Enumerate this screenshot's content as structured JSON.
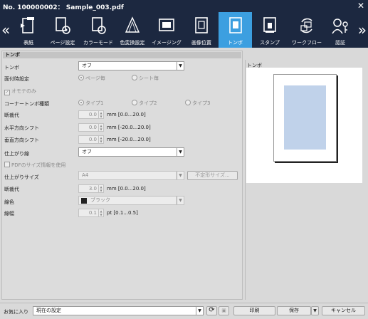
{
  "window": {
    "title": "No. 100000002： Sample_003.pdf"
  },
  "ribbon": {
    "tabs": [
      {
        "label": "表紙",
        "icon": "cover-icon"
      },
      {
        "label": "ページ設定",
        "icon": "page-settings-icon"
      },
      {
        "label": "カラーモード",
        "icon": "color-mode-icon"
      },
      {
        "label": "色変換設定",
        "icon": "color-conversion-icon"
      },
      {
        "label": "イメージング",
        "icon": "imaging-icon"
      },
      {
        "label": "画像位置",
        "icon": "image-position-icon"
      },
      {
        "label": "トンボ",
        "icon": "crop-marks-icon",
        "active": true
      },
      {
        "label": "スタンプ",
        "icon": "stamp-icon"
      },
      {
        "label": "ワークフロー",
        "icon": "workflow-icon"
      },
      {
        "label": "認証",
        "icon": "auth-icon"
      }
    ]
  },
  "section": {
    "title": "トンボ"
  },
  "form": {
    "tombo_label": "トンボ",
    "tombo_value": "オフ",
    "binding_label": "面付時設定",
    "per_page": "ページ毎",
    "per_sheet": "シート毎",
    "front_only": "オモテのみ",
    "corner_label": "コーナートンボ種類",
    "type1": "タイプ1",
    "type2": "タイプ2",
    "type3": "タイプ3",
    "bleed_label": "断裁代",
    "bleed_value": "0.0",
    "bleed_unit": "mm [0.0...20.0]",
    "hshift_label": "水平方向シフト",
    "hshift_value": "0.0",
    "hshift_unit": "mm [-20.0...20.0]",
    "vshift_label": "垂直方向シフト",
    "vshift_value": "0.0",
    "vshift_unit": "mm [-20.0...20.0]",
    "finish_label": "仕上がり線",
    "finish_value": "オフ",
    "use_pdf_size": "PDFのサイズ情報を使用",
    "finish_size_label": "仕上がりサイズ",
    "finish_size_value": "A4",
    "custom_size_button": "不定形サイズ...",
    "bleed2_label": "断裁代",
    "bleed2_value": "3.0",
    "bleed2_unit": "mm [0.0...20.0]",
    "line_color_label": "線色",
    "line_color_value": "ブラック",
    "line_width_label": "線幅",
    "line_width_value": "0.1",
    "line_width_unit": "pt [0.1...0.5]"
  },
  "preview": {
    "title": "トンボ"
  },
  "footer": {
    "favorites_label": "お気に入り",
    "favorites_value": "現在の設定",
    "print_button": "印刷",
    "save_button": "保存",
    "cancel_button": "キャンセル"
  },
  "colors": {
    "titlebar": "#1c2840",
    "active_tab": "#3c9fe0",
    "preview_inner": "#c0d2ea"
  }
}
